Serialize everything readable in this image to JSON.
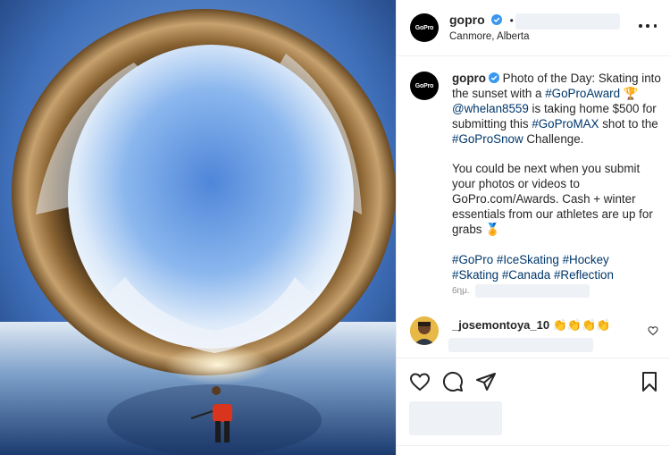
{
  "post": {
    "username": "gopro",
    "location": "Canmore, Alberta",
    "avatar_text": "GoPro",
    "dot": "•"
  },
  "caption": {
    "username": "gopro",
    "line1_text": "Photo of the Day: Skating into the sunset with a ",
    "hashtag_award": "#GoProAward",
    "trophy": "🏆",
    "mention": "@whelan8559",
    "line2_text": " is taking home $500 for submitting this ",
    "hashtag_max": "#GoProMAX",
    "line3_text": " shot to the ",
    "hashtag_snow": "#GoProSnow",
    "line4_text": " Challenge.",
    "para2": "You could be next when you submit your photos or videos to GoPro.com/Awards. Cash + winter essentials from our athletes are up for grabs",
    "medal": "🏅",
    "tags": [
      "#GoPro",
      "#IceSkating",
      "#Hockey",
      "#Skating",
      "#Canada",
      "#Reflection"
    ]
  },
  "timestamp": "6ημ.",
  "comment": {
    "username": "_josemontoya_10",
    "text": "👏👏👏👏"
  },
  "colors": {
    "link": "#00376b",
    "verified": "#3897f0",
    "muted": "#8e8e8e",
    "divider": "#efefef"
  },
  "icons": [
    "more-options-icon",
    "verified-icon",
    "like-heart-icon",
    "comment-icon",
    "share-icon",
    "save-bookmark-icon",
    "comment-like-icon"
  ]
}
